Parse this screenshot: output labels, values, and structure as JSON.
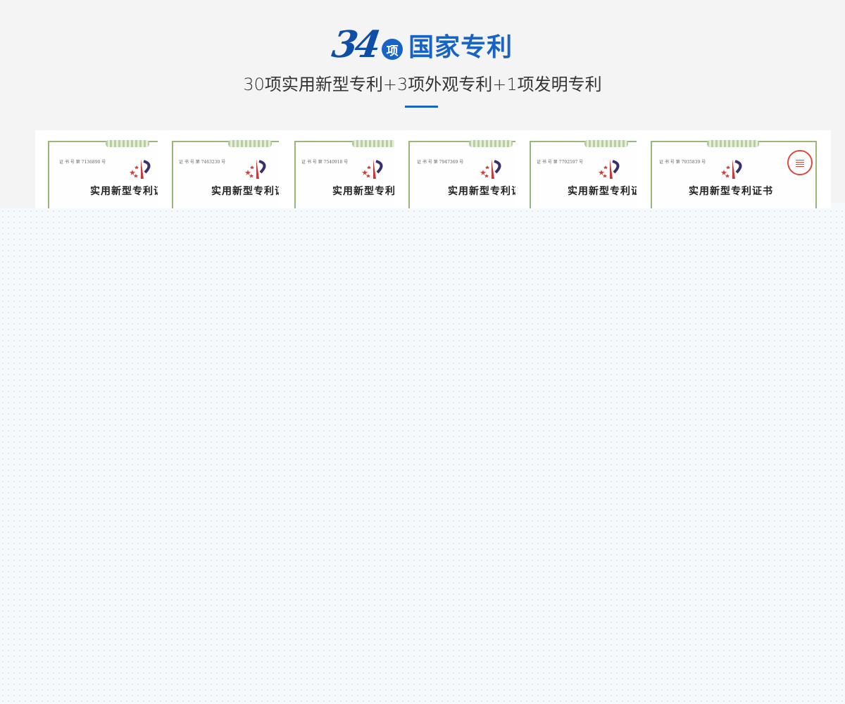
{
  "section": {
    "number": "34",
    "badge": "项",
    "title": "国家专利",
    "subtitle": "30项实用新型专利+3项外观专利+1项发明专利",
    "accent_color": "#1764c6"
  },
  "certificates": [
    {
      "name": "实用新型专利证书",
      "cert_no": "证 书 号 第 7136890 号"
    },
    {
      "name": "实用新型专利证书",
      "cert_no": "证 书 号 第 7463230 号"
    },
    {
      "name": "实用新型专利证书",
      "cert_no": "证 书 号 第 7540918 号"
    },
    {
      "name": "实用新型专利证书",
      "cert_no": "证 书 号 第 7947369 号"
    },
    {
      "name": "实用新型专利证书",
      "cert_no": "证 书 号 第 7792597 号"
    },
    {
      "name": "实用新型专利证书",
      "cert_no": "证 书 号 第 7935839 号"
    }
  ]
}
